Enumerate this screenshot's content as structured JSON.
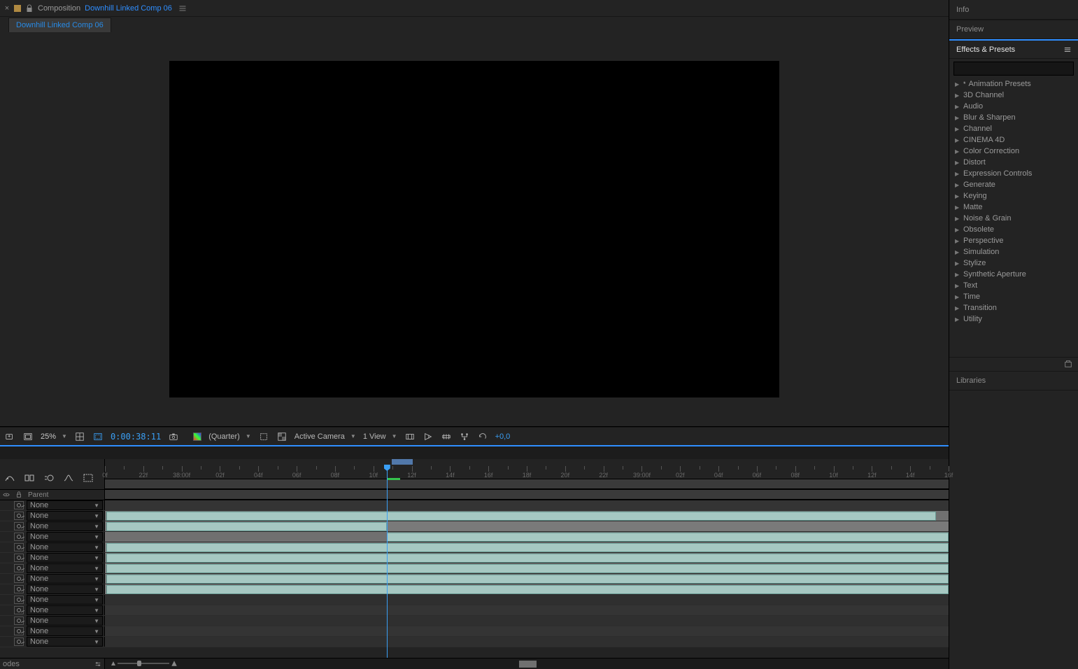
{
  "compPanel": {
    "label": "Composition",
    "name": "Downhill Linked Comp 06",
    "tab": "Downhill Linked Comp 06"
  },
  "viewerBar": {
    "zoom": "25%",
    "timecode": "0:00:38:11",
    "resolution": "(Quarter)",
    "camera": "Active Camera",
    "views": "1 View",
    "exposure": "+0,0"
  },
  "sidePanels": {
    "info": "Info",
    "preview": "Preview",
    "effects": "Effects & Presets",
    "libraries": "Libraries"
  },
  "effectsList": {
    "search_placeholder": "",
    "items": [
      "Animation Presets",
      "3D Channel",
      "Audio",
      "Blur & Sharpen",
      "Channel",
      "CINEMA 4D",
      "Color Correction",
      "Distort",
      "Expression Controls",
      "Generate",
      "Keying",
      "Matte",
      "Noise & Grain",
      "Obsolete",
      "Perspective",
      "Simulation",
      "Stylize",
      "Synthetic Aperture",
      "Text",
      "Time",
      "Transition",
      "Utility"
    ]
  },
  "timeline": {
    "header_parent": "Parent",
    "footer_label": "odes",
    "none": "None",
    "ruler": [
      "0f",
      "22f",
      "38:00f",
      "02f",
      "04f",
      "06f",
      "08f",
      "10f",
      "12f",
      "14f",
      "16f",
      "18f",
      "20f",
      "22f",
      "39:00f",
      "02f",
      "04f",
      "06f",
      "08f",
      "10f",
      "12f",
      "14f",
      "16f"
    ],
    "workArea": {
      "start_pct": 34.0,
      "end_pct": 36.5
    },
    "cti_pct": 33.4,
    "green_seg": {
      "start_pct": 33.4,
      "end_pct": 35.0
    },
    "rows": [
      {
        "fill": false,
        "even": false
      },
      {
        "fill": true,
        "even": true,
        "bar": {
          "start_pct": 0.2,
          "end_pct": 98.5
        }
      },
      {
        "fill": true,
        "even": false,
        "bar": {
          "start_pct": 0.2,
          "end_pct": 33.4
        }
      },
      {
        "fill": true,
        "even": true,
        "bar": {
          "start_pct": 33.4,
          "end_pct": 100.0
        }
      },
      {
        "fill": true,
        "even": false,
        "bar": {
          "start_pct": 0.2,
          "end_pct": 100.0
        }
      },
      {
        "fill": true,
        "even": true,
        "bar": {
          "start_pct": 0.2,
          "end_pct": 100.0
        }
      },
      {
        "fill": true,
        "even": false,
        "bar": {
          "start_pct": 0.2,
          "end_pct": 100.0
        }
      },
      {
        "fill": true,
        "even": true,
        "bar": {
          "start_pct": 0.2,
          "end_pct": 100.0
        }
      },
      {
        "fill": true,
        "even": false,
        "bar": {
          "start_pct": 0.2,
          "end_pct": 100.0
        }
      },
      {
        "fill": false,
        "even": true
      },
      {
        "fill": false,
        "even": false
      },
      {
        "fill": false,
        "even": true
      },
      {
        "fill": false,
        "even": false
      },
      {
        "fill": false,
        "even": true
      }
    ],
    "scroll_thumb": {
      "left_pct": 40,
      "width_pct": 2
    },
    "zoom_thumb_pct": 40
  }
}
